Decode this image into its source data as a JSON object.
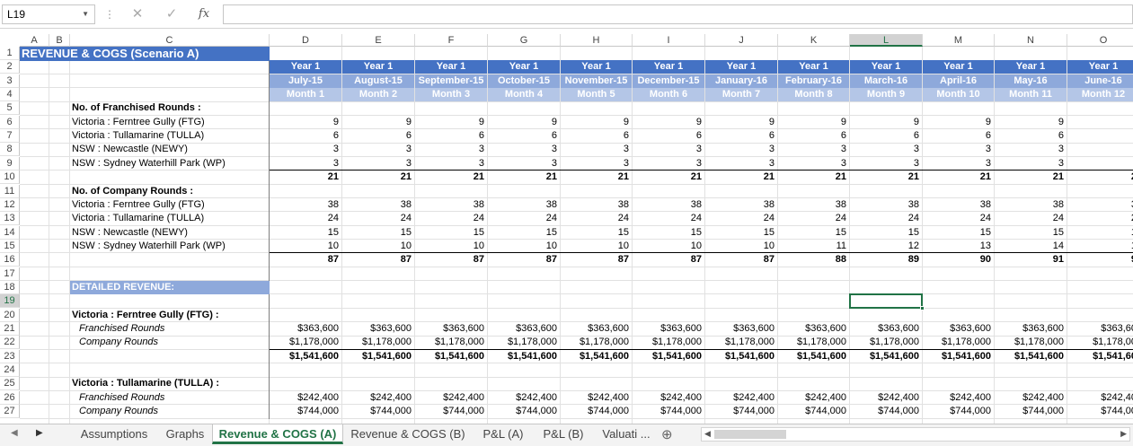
{
  "namebox": "L19",
  "formula_bar": {
    "cancel_icon": "✕",
    "enter_icon": "✓",
    "fx_label": "fx",
    "value": ""
  },
  "columns": [
    "A",
    "B",
    "C",
    "D",
    "E",
    "F",
    "G",
    "H",
    "I",
    "J",
    "K",
    "L",
    "M",
    "N",
    "O"
  ],
  "rows": [
    "1",
    "2",
    "3",
    "4",
    "5",
    "6",
    "7",
    "8",
    "9",
    "10",
    "11",
    "12",
    "13",
    "14",
    "15",
    "16",
    "17",
    "18",
    "19",
    "20",
    "21",
    "22",
    "23",
    "24",
    "25",
    "26",
    "27"
  ],
  "title": "REVENUE & COGS (Scenario A)",
  "periods": {
    "year": [
      "Year 1",
      "Year 1",
      "Year 1",
      "Year 1",
      "Year 1",
      "Year 1",
      "Year 1",
      "Year 1",
      "Year 1",
      "Year 1",
      "Year 1",
      "Year 1"
    ],
    "month_name": [
      "July-15",
      "August-15",
      "September-15",
      "October-15",
      "November-15",
      "December-15",
      "January-16",
      "February-16",
      "March-16",
      "April-16",
      "May-16",
      "June-16"
    ],
    "month_num": [
      "Month 1",
      "Month 2",
      "Month 3",
      "Month 4",
      "Month 5",
      "Month 6",
      "Month 7",
      "Month 8",
      "Month 9",
      "Month 10",
      "Month 11",
      "Month 12"
    ]
  },
  "labels": {
    "r5": "No. of Franchised Rounds :",
    "r6": "Victoria : Ferntree Gully (FTG)",
    "r7": "Victoria : Tullamarine (TULLA)",
    "r8": "NSW : Newcastle (NEWY)",
    "r9": "NSW : Sydney Waterhill Park (WP)",
    "r11": "No. of Company Rounds :",
    "r12": "Victoria : Ferntree Gully (FTG)",
    "r13": "Victoria : Tullamarine (TULLA)",
    "r14": "NSW : Newcastle (NEWY)",
    "r15": "NSW : Sydney Waterhill Park (WP)",
    "r18": "DETAILED REVENUE:",
    "r20": "Victoria : Ferntree Gully (FTG) :",
    "r21": "Franchised Rounds",
    "r22": "Company Rounds",
    "r25": "Victoria : Tullamarine (TULLA) :",
    "r26": "Franchised Rounds",
    "r27": "Company Rounds"
  },
  "values": {
    "r6": [
      "9",
      "9",
      "9",
      "9",
      "9",
      "9",
      "9",
      "9",
      "9",
      "9",
      "9",
      ""
    ],
    "r7": [
      "6",
      "6",
      "6",
      "6",
      "6",
      "6",
      "6",
      "6",
      "6",
      "6",
      "6",
      ""
    ],
    "r8": [
      "3",
      "3",
      "3",
      "3",
      "3",
      "3",
      "3",
      "3",
      "3",
      "3",
      "3",
      ""
    ],
    "r9": [
      "3",
      "3",
      "3",
      "3",
      "3",
      "3",
      "3",
      "3",
      "3",
      "3",
      "3",
      ""
    ],
    "r10": [
      "21",
      "21",
      "21",
      "21",
      "21",
      "21",
      "21",
      "21",
      "21",
      "21",
      "21",
      "2"
    ],
    "r12": [
      "38",
      "38",
      "38",
      "38",
      "38",
      "38",
      "38",
      "38",
      "38",
      "38",
      "38",
      "3"
    ],
    "r13": [
      "24",
      "24",
      "24",
      "24",
      "24",
      "24",
      "24",
      "24",
      "24",
      "24",
      "24",
      "2"
    ],
    "r14": [
      "15",
      "15",
      "15",
      "15",
      "15",
      "15",
      "15",
      "15",
      "15",
      "15",
      "15",
      "1"
    ],
    "r15": [
      "10",
      "10",
      "10",
      "10",
      "10",
      "10",
      "10",
      "11",
      "12",
      "13",
      "14",
      "1"
    ],
    "r16": [
      "87",
      "87",
      "87",
      "87",
      "87",
      "87",
      "87",
      "88",
      "89",
      "90",
      "91",
      "9"
    ],
    "r21": [
      "$363,600",
      "$363,600",
      "$363,600",
      "$363,600",
      "$363,600",
      "$363,600",
      "$363,600",
      "$363,600",
      "$363,600",
      "$363,600",
      "$363,600",
      "$363,60"
    ],
    "r22": [
      "$1,178,000",
      "$1,178,000",
      "$1,178,000",
      "$1,178,000",
      "$1,178,000",
      "$1,178,000",
      "$1,178,000",
      "$1,178,000",
      "$1,178,000",
      "$1,178,000",
      "$1,178,000",
      "$1,178,00"
    ],
    "r23": [
      "$1,541,600",
      "$1,541,600",
      "$1,541,600",
      "$1,541,600",
      "$1,541,600",
      "$1,541,600",
      "$1,541,600",
      "$1,541,600",
      "$1,541,600",
      "$1,541,600",
      "$1,541,600",
      "$1,541,60"
    ],
    "r26": [
      "$242,400",
      "$242,400",
      "$242,400",
      "$242,400",
      "$242,400",
      "$242,400",
      "$242,400",
      "$242,400",
      "$242,400",
      "$242,400",
      "$242,400",
      "$242,40"
    ],
    "r27": [
      "$744,000",
      "$744,000",
      "$744,000",
      "$744,000",
      "$744,000",
      "$744,000",
      "$744,000",
      "$744,000",
      "$744,000",
      "$744,000",
      "$744,000",
      "$744,00"
    ]
  },
  "tabs": [
    "Assumptions",
    "Graphs",
    "Revenue & COGS (A)",
    "Revenue & COGS (B)",
    "P&L (A)",
    "P&L (B)",
    "Valuati ..."
  ],
  "active_tab": "Revenue & COGS (A)",
  "colors": {
    "accent": "#217346",
    "header_dark": "#4472c4",
    "header_mid": "#8ea9db",
    "header_light": "#b4c6e7"
  }
}
